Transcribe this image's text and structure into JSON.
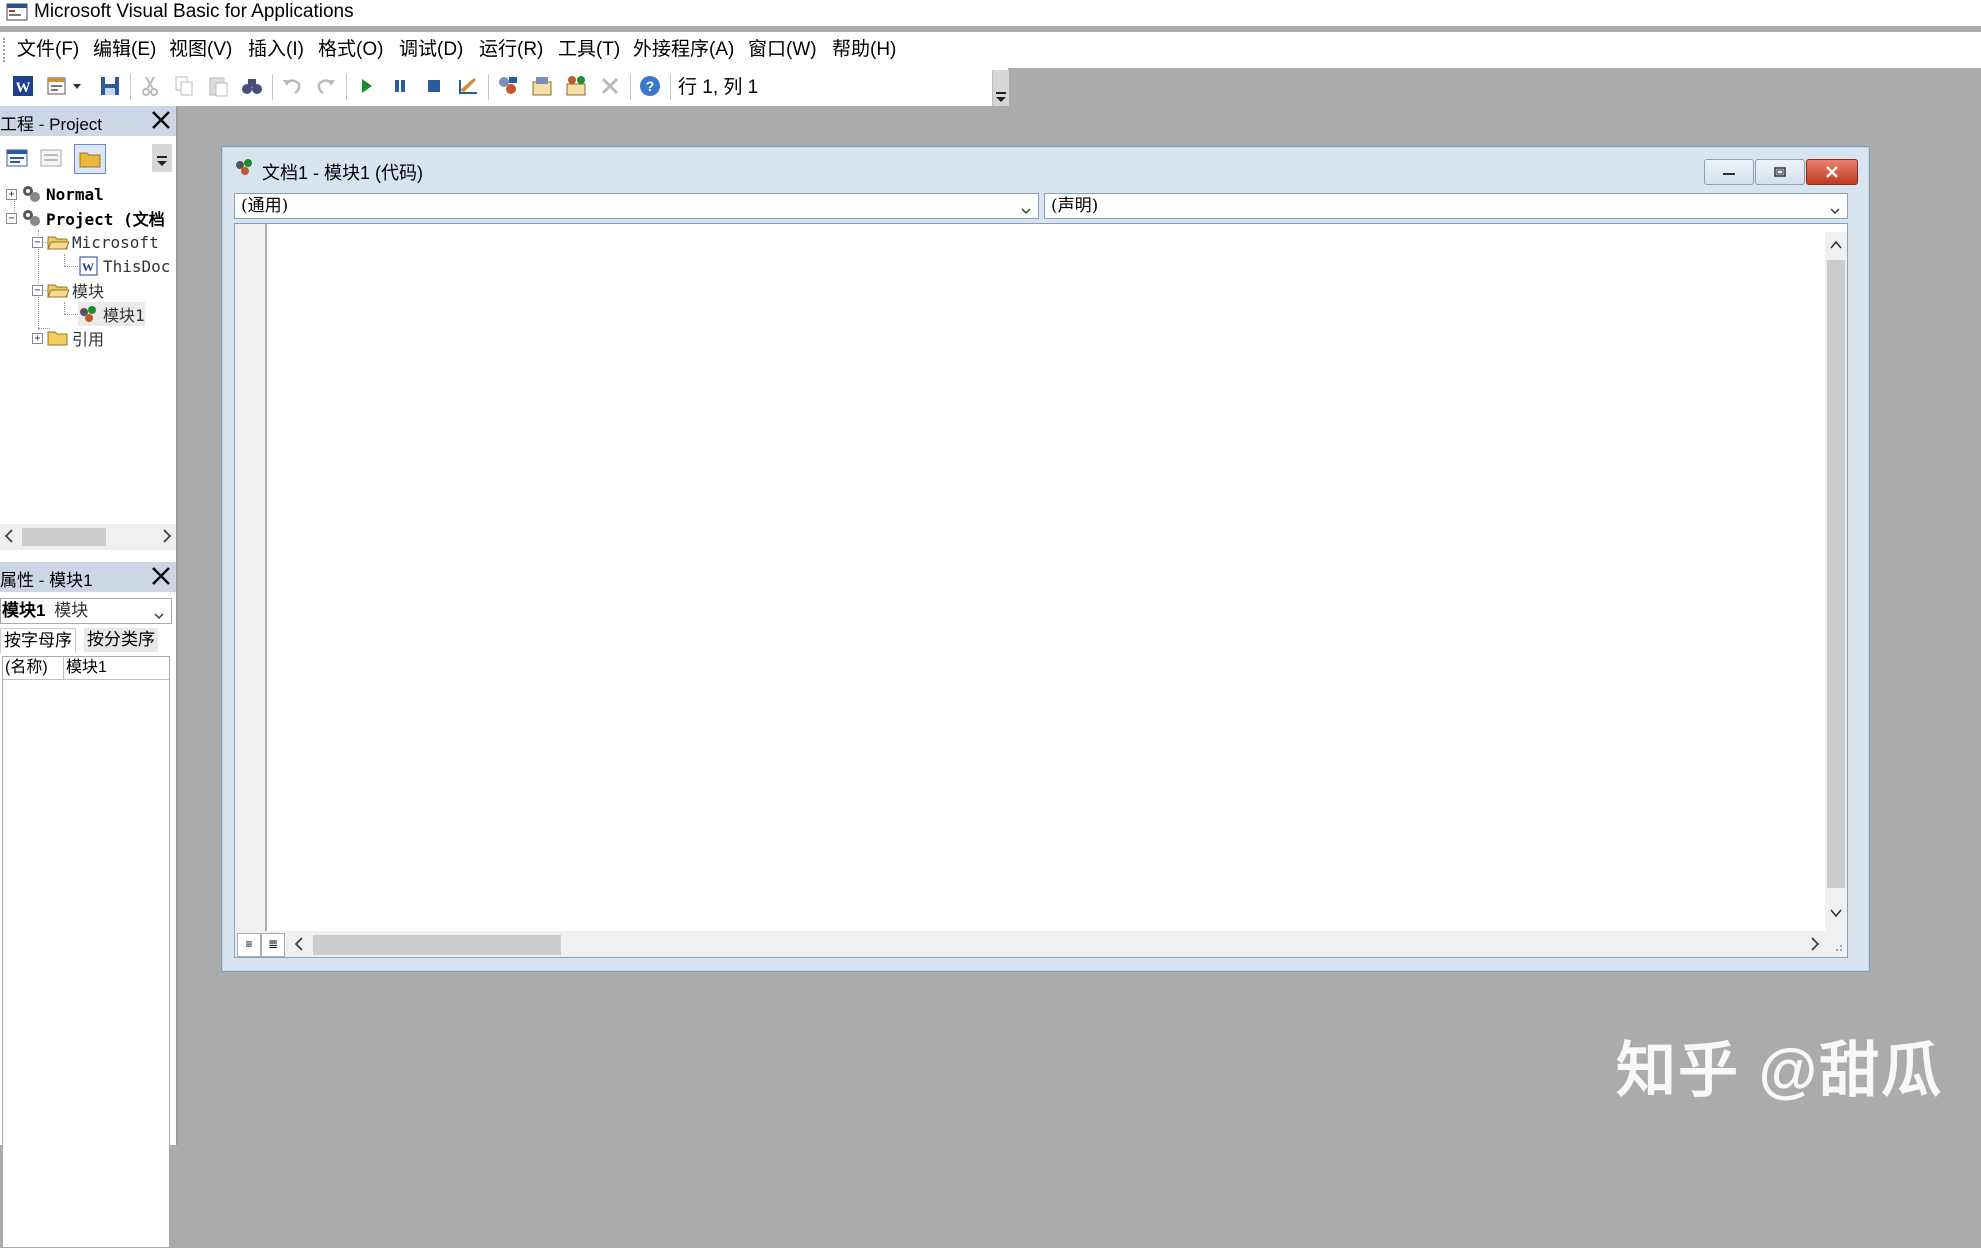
{
  "app": {
    "title": "Microsoft Visual Basic for Applications"
  },
  "menu": [
    "文件(F)",
    "编辑(E)",
    "视图(V)",
    "插入(I)",
    "格式(O)",
    "调试(D)",
    "运行(R)",
    "工具(T)",
    "外接程序(A)",
    "窗口(W)",
    "帮助(H)"
  ],
  "toolbar": {
    "cursor_position": "行 1, 列 1"
  },
  "project_pane": {
    "title": "工程 - Project",
    "tree": [
      {
        "label": "Normal"
      },
      {
        "label": "Project (文档"
      },
      {
        "label": "Microsoft"
      },
      {
        "label": "ThisDoc"
      },
      {
        "label": "模块"
      },
      {
        "label": "模块1"
      },
      {
        "label": "引用"
      }
    ]
  },
  "properties_pane": {
    "title": "属性 - 模块1",
    "object_select": {
      "name": "模块1",
      "type": "模块"
    },
    "tabs": [
      "按字母序",
      "按分类序"
    ],
    "rows": [
      {
        "name": "(名称)",
        "value": "模块1"
      }
    ]
  },
  "code_window": {
    "title": "文档1 - 模块1 (代码)",
    "object_combo": "(通用)",
    "procedure_combo": "(声明)"
  },
  "watermark": "知乎 @甜瓜"
}
